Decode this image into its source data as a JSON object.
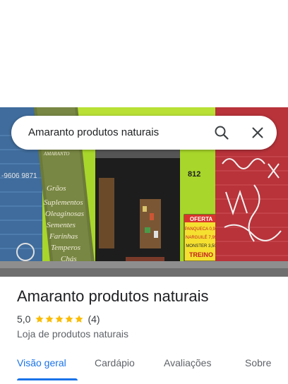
{
  "search": {
    "query": "Amaranto produtos naturais"
  },
  "place": {
    "name": "Amaranto produtos naturais",
    "rating": "5,0",
    "stars": 5,
    "review_count": "(4)",
    "category": "Loja de produtos naturais"
  },
  "photo": {
    "store_number": "812",
    "banner_lines": [
      "AMARANTO",
      "Grãos",
      "Suplementos",
      "Oleaginosas",
      "Sementes",
      "Farinhas",
      "Temperos",
      "Chás"
    ],
    "sign_header": "OFERTA",
    "sign_lines": [
      "PANQUECA 0,99",
      "NARGUILÉ 7,99",
      "MONSTER 3,50",
      "TREINO"
    ],
    "left_phone": "-9606 9871"
  },
  "tabs": [
    {
      "label": "Visão geral",
      "active": true
    },
    {
      "label": "Cardápio",
      "active": false
    },
    {
      "label": "Avaliações",
      "active": false
    },
    {
      "label": "Sobre",
      "active": false
    }
  ],
  "colors": {
    "accent": "#1a73e8",
    "star": "#fbbc04",
    "storefront": "#a8d62a"
  }
}
